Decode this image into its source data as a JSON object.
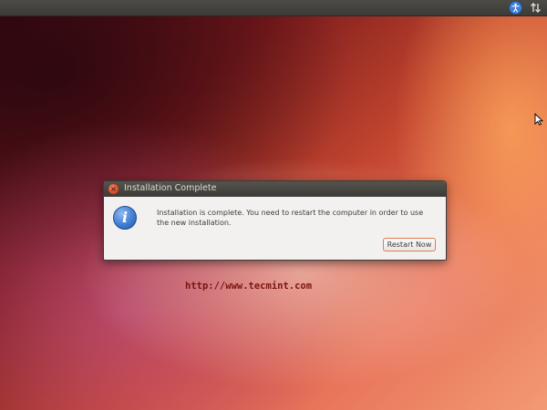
{
  "panel": {
    "icons": [
      "accessibility-icon",
      "network-updown-icon"
    ]
  },
  "dialog": {
    "title": "Installation Complete",
    "close_icon": "close-icon",
    "info_icon": "information-icon",
    "info_glyph": "i",
    "message": "Installation is complete. You need to restart the computer in order to use the new installation.",
    "restart_button_label": "Restart Now"
  },
  "watermark": {
    "text": "http://www.tecmint.com"
  },
  "colors": {
    "panel": "#3c3b37",
    "dialog_background": "#f2f1f0",
    "close_button": "#df4b25",
    "button_focus_border": "#e37a52",
    "info_icon": "#3f7fd5",
    "watermark": "#7a1410"
  }
}
